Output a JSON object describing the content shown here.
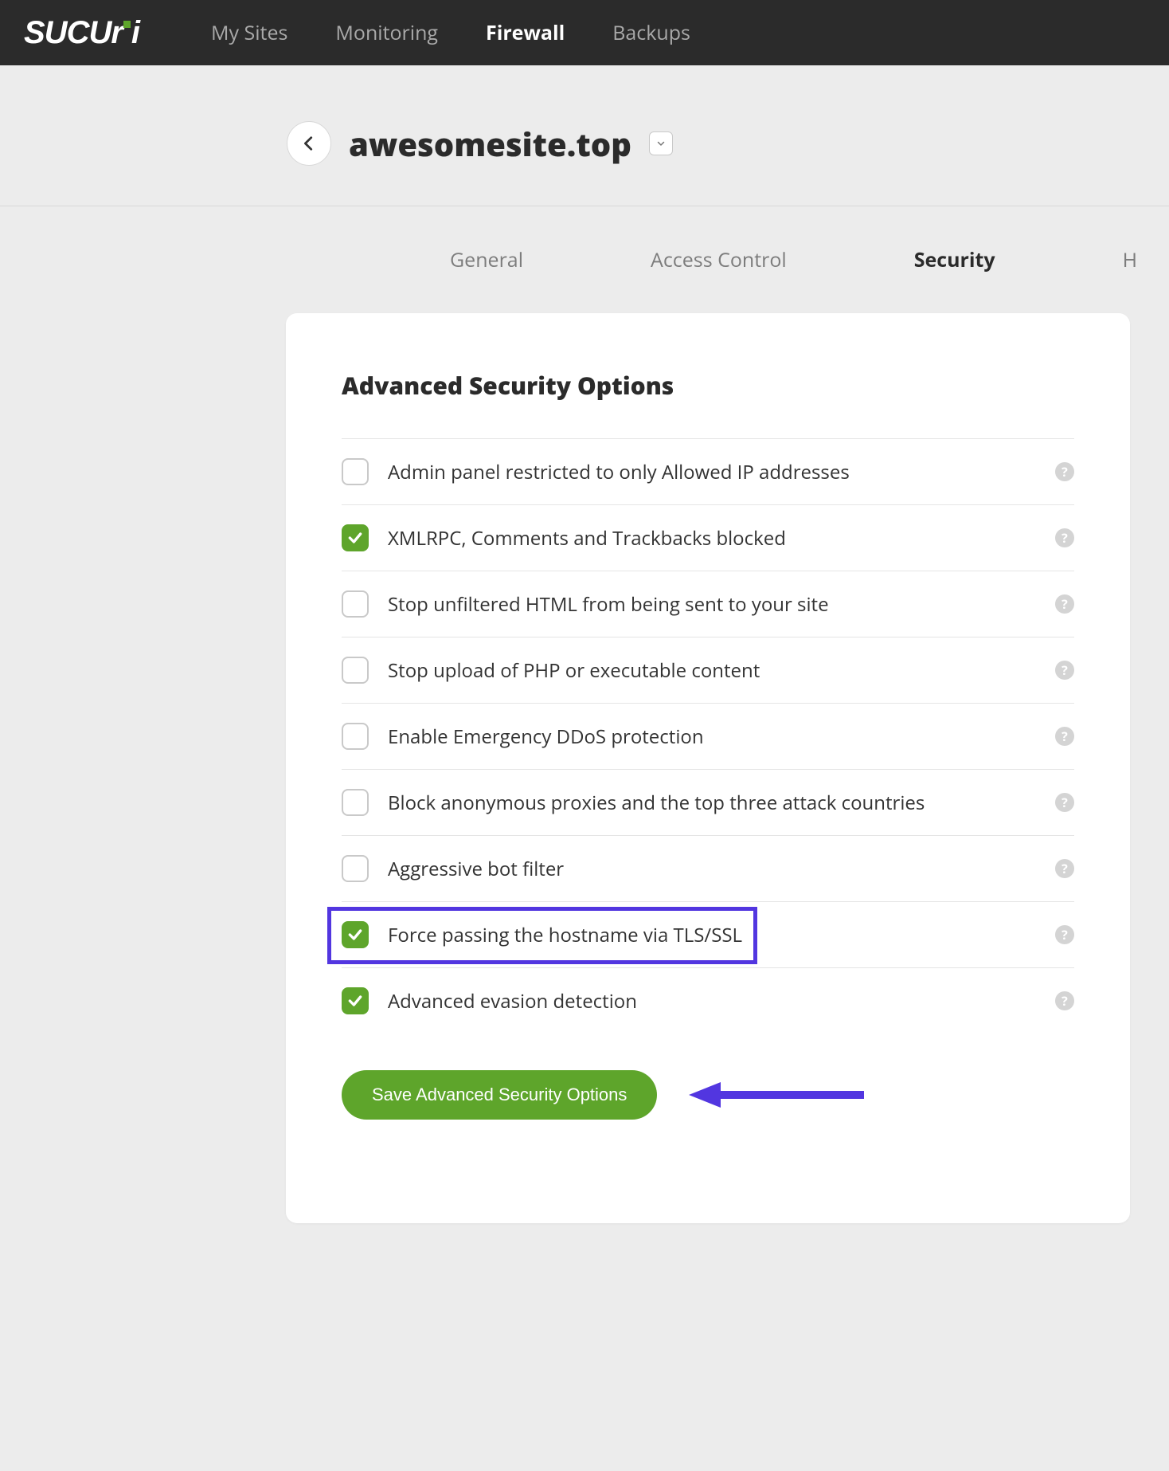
{
  "logo_text": "SUCURI",
  "nav": {
    "my_sites": "My Sites",
    "monitoring": "Monitoring",
    "firewall": "Firewall",
    "backups": "Backups"
  },
  "site": {
    "name": "awesomesite.top"
  },
  "subtabs": {
    "general": "General",
    "access_control": "Access Control",
    "security": "Security",
    "https": "H"
  },
  "card": {
    "title": "Advanced Security Options",
    "options": [
      {
        "label": "Admin panel restricted to only Allowed IP addresses",
        "checked": false
      },
      {
        "label": "XMLRPC, Comments and Trackbacks blocked",
        "checked": true
      },
      {
        "label": "Stop unfiltered HTML from being sent to your site",
        "checked": false
      },
      {
        "label": "Stop upload of PHP or executable content",
        "checked": false
      },
      {
        "label": "Enable Emergency DDoS protection",
        "checked": false
      },
      {
        "label": "Block anonymous proxies and the top three attack countries",
        "checked": false
      },
      {
        "label": "Aggressive bot filter",
        "checked": false
      },
      {
        "label": "Force passing the hostname via TLS/SSL",
        "checked": true
      },
      {
        "label": "Advanced evasion detection",
        "checked": true
      }
    ],
    "save_label": "Save Advanced Security Options"
  },
  "help_glyph": "?",
  "annotations": {
    "highlighted_option_index": 7,
    "arrow_color": "#5236e0"
  }
}
